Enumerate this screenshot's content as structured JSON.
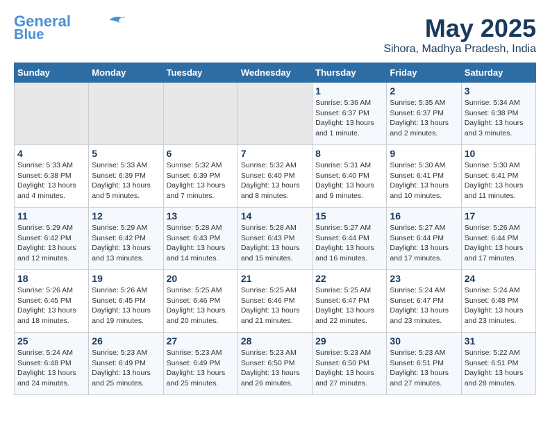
{
  "header": {
    "logo_line1": "General",
    "logo_line2": "Blue",
    "month": "May 2025",
    "location": "Sihora, Madhya Pradesh, India"
  },
  "weekdays": [
    "Sunday",
    "Monday",
    "Tuesday",
    "Wednesday",
    "Thursday",
    "Friday",
    "Saturday"
  ],
  "weeks": [
    [
      {
        "day": "",
        "info": ""
      },
      {
        "day": "",
        "info": ""
      },
      {
        "day": "",
        "info": ""
      },
      {
        "day": "",
        "info": ""
      },
      {
        "day": "1",
        "info": "Sunrise: 5:36 AM\nSunset: 6:37 PM\nDaylight: 13 hours\nand 1 minute."
      },
      {
        "day": "2",
        "info": "Sunrise: 5:35 AM\nSunset: 6:37 PM\nDaylight: 13 hours\nand 2 minutes."
      },
      {
        "day": "3",
        "info": "Sunrise: 5:34 AM\nSunset: 6:38 PM\nDaylight: 13 hours\nand 3 minutes."
      }
    ],
    [
      {
        "day": "4",
        "info": "Sunrise: 5:33 AM\nSunset: 6:38 PM\nDaylight: 13 hours\nand 4 minutes."
      },
      {
        "day": "5",
        "info": "Sunrise: 5:33 AM\nSunset: 6:39 PM\nDaylight: 13 hours\nand 5 minutes."
      },
      {
        "day": "6",
        "info": "Sunrise: 5:32 AM\nSunset: 6:39 PM\nDaylight: 13 hours\nand 7 minutes."
      },
      {
        "day": "7",
        "info": "Sunrise: 5:32 AM\nSunset: 6:40 PM\nDaylight: 13 hours\nand 8 minutes."
      },
      {
        "day": "8",
        "info": "Sunrise: 5:31 AM\nSunset: 6:40 PM\nDaylight: 13 hours\nand 9 minutes."
      },
      {
        "day": "9",
        "info": "Sunrise: 5:30 AM\nSunset: 6:41 PM\nDaylight: 13 hours\nand 10 minutes."
      },
      {
        "day": "10",
        "info": "Sunrise: 5:30 AM\nSunset: 6:41 PM\nDaylight: 13 hours\nand 11 minutes."
      }
    ],
    [
      {
        "day": "11",
        "info": "Sunrise: 5:29 AM\nSunset: 6:42 PM\nDaylight: 13 hours\nand 12 minutes."
      },
      {
        "day": "12",
        "info": "Sunrise: 5:29 AM\nSunset: 6:42 PM\nDaylight: 13 hours\nand 13 minutes."
      },
      {
        "day": "13",
        "info": "Sunrise: 5:28 AM\nSunset: 6:43 PM\nDaylight: 13 hours\nand 14 minutes."
      },
      {
        "day": "14",
        "info": "Sunrise: 5:28 AM\nSunset: 6:43 PM\nDaylight: 13 hours\nand 15 minutes."
      },
      {
        "day": "15",
        "info": "Sunrise: 5:27 AM\nSunset: 6:44 PM\nDaylight: 13 hours\nand 16 minutes."
      },
      {
        "day": "16",
        "info": "Sunrise: 5:27 AM\nSunset: 6:44 PM\nDaylight: 13 hours\nand 17 minutes."
      },
      {
        "day": "17",
        "info": "Sunrise: 5:26 AM\nSunset: 6:44 PM\nDaylight: 13 hours\nand 17 minutes."
      }
    ],
    [
      {
        "day": "18",
        "info": "Sunrise: 5:26 AM\nSunset: 6:45 PM\nDaylight: 13 hours\nand 18 minutes."
      },
      {
        "day": "19",
        "info": "Sunrise: 5:26 AM\nSunset: 6:45 PM\nDaylight: 13 hours\nand 19 minutes."
      },
      {
        "day": "20",
        "info": "Sunrise: 5:25 AM\nSunset: 6:46 PM\nDaylight: 13 hours\nand 20 minutes."
      },
      {
        "day": "21",
        "info": "Sunrise: 5:25 AM\nSunset: 6:46 PM\nDaylight: 13 hours\nand 21 minutes."
      },
      {
        "day": "22",
        "info": "Sunrise: 5:25 AM\nSunset: 6:47 PM\nDaylight: 13 hours\nand 22 minutes."
      },
      {
        "day": "23",
        "info": "Sunrise: 5:24 AM\nSunset: 6:47 PM\nDaylight: 13 hours\nand 23 minutes."
      },
      {
        "day": "24",
        "info": "Sunrise: 5:24 AM\nSunset: 6:48 PM\nDaylight: 13 hours\nand 23 minutes."
      }
    ],
    [
      {
        "day": "25",
        "info": "Sunrise: 5:24 AM\nSunset: 6:48 PM\nDaylight: 13 hours\nand 24 minutes."
      },
      {
        "day": "26",
        "info": "Sunrise: 5:23 AM\nSunset: 6:49 PM\nDaylight: 13 hours\nand 25 minutes."
      },
      {
        "day": "27",
        "info": "Sunrise: 5:23 AM\nSunset: 6:49 PM\nDaylight: 13 hours\nand 25 minutes."
      },
      {
        "day": "28",
        "info": "Sunrise: 5:23 AM\nSunset: 6:50 PM\nDaylight: 13 hours\nand 26 minutes."
      },
      {
        "day": "29",
        "info": "Sunrise: 5:23 AM\nSunset: 6:50 PM\nDaylight: 13 hours\nand 27 minutes."
      },
      {
        "day": "30",
        "info": "Sunrise: 5:23 AM\nSunset: 6:51 PM\nDaylight: 13 hours\nand 27 minutes."
      },
      {
        "day": "31",
        "info": "Sunrise: 5:22 AM\nSunset: 6:51 PM\nDaylight: 13 hours\nand 28 minutes."
      }
    ]
  ]
}
